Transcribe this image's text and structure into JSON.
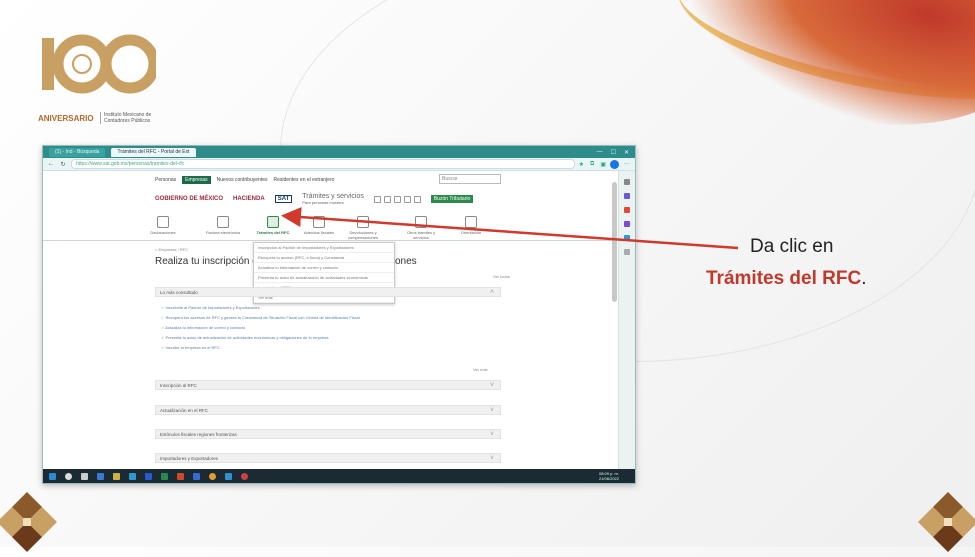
{
  "logo": {
    "number": "100",
    "anniversary": "ANIVERSARIO",
    "institute": "Instituto Mexicano de Contadores Públicos"
  },
  "browser": {
    "tabs": [
      "(1) - Ind - Búsqueda",
      "Trámites del RFC - Portal de Ext"
    ],
    "url": "https://www.sat.gob.mx/personas/tramites-del-rfc"
  },
  "site": {
    "topnav": [
      "Personas",
      "Empresas",
      "Nuevos contribuyentes",
      "Residentes en el extranjero"
    ],
    "topnav_active": "Empresas",
    "search_placeholder": "Buscar",
    "brand": {
      "gobierno": "GOBIERNO DE MÉXICO",
      "hacienda": "HACIENDA",
      "sat": "SAT",
      "tramites": "Trámites y servicios",
      "tramites_sub": "Para personas morales",
      "buzon": "Buzón Tributario"
    },
    "icons": [
      {
        "label": "Declaraciones"
      },
      {
        "label": "Factura electrónica"
      },
      {
        "label": "Trámites del RFC"
      },
      {
        "label": "Adeudos fiscales"
      },
      {
        "label": "Devoluciones y compensaciones"
      },
      {
        "label": "Otros trámites y servicios"
      },
      {
        "label": "Orientación"
      }
    ],
    "dropdown": [
      "Inscripción al Padrón de Importadores y Exportadores",
      "Recupera tu acceso (RFC, e.firma) y Constancia",
      "Actualiza tu información de correo y contacto",
      "Presenta tu aviso de actualización de actividades económicas",
      "Inscripción al RFC",
      "Ver más"
    ],
    "breadcrumb": "< Empresas / RFC",
    "page_title_start": "Realiza tu inscripción o ac",
    "page_title_end": "ones",
    "expand_all": "Ver todos",
    "accordion": {
      "most_consulted": "Lo más consultado",
      "faqs": [
        "Inscríbete al Padrón de Importadores y Exportadores",
        "Recupera tus accesos de RFC y genera tu Constancia de Situación Fiscal con Cédula de Identificación Fiscal",
        "Actualiza tu información de correo y contacto",
        "Presenta tu aviso de actualización de actividades económicas y obligaciones de tu empresa",
        "Inscribe tu empresa en el RFC"
      ],
      "see_more": "Ver más",
      "sections": [
        "Inscripción al RFC",
        "Actualización en el RFC",
        "Estímulos fiscales regiones fronterizas",
        "Importadores y Exportadores"
      ]
    }
  },
  "taskbar": {
    "time": "08:09 p. m.",
    "date": "21/06/2022"
  },
  "callout": {
    "line1": "Da clic en",
    "line2": "Trámites del RFC",
    "punct": ".",
    "color": "#c0392b"
  }
}
